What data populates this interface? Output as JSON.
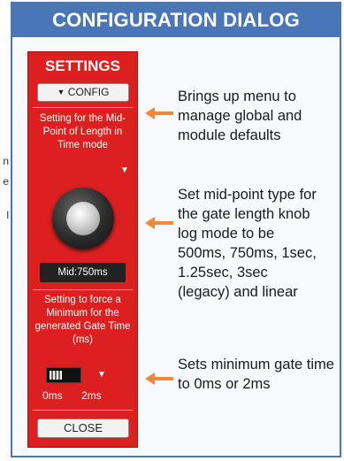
{
  "background_text": [
    "n",
    "e",
    "l"
  ],
  "dialog": {
    "title": "CONFIGURATION DIALOG"
  },
  "panel": {
    "heading": "SETTINGS",
    "config_button": "CONFIG",
    "midpoint_setting": {
      "label": "Setting for the Mid-Point of Length in Time mode",
      "readout": "Mid:750ms"
    },
    "minimum_setting": {
      "label": "Setting to force a Minimum for the generated Gate Time (ms)",
      "options": [
        "0ms",
        "2ms"
      ],
      "selected": "0ms"
    },
    "close_button": "CLOSE"
  },
  "annotations": [
    "Brings up menu to manage global and module defaults",
    "Set mid-point type for the gate length knob log mode to be 500ms, 750ms, 1sec, 1.25sec, 3sec (legacy) and linear",
    "Sets minimum gate time to 0ms or 2ms"
  ],
  "colors": {
    "title_bar": "#4a76b8",
    "panel": "#dc1f1f",
    "arrow": "#f0883a"
  },
  "icons": {
    "config_caret": "triangle-down",
    "dropdown": "triangle-down",
    "annotation_arrow": "arrow-left"
  }
}
